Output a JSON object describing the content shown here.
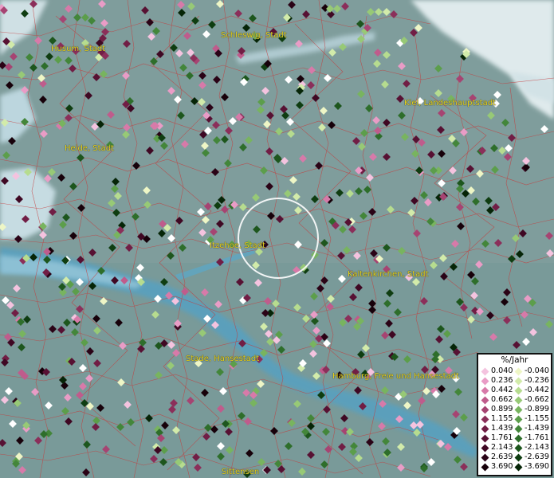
{
  "map": {
    "cities": [
      {
        "name": "Husum, Stadt"
      },
      {
        "name": "Schleswig, Stadt"
      },
      {
        "name": "Kiel, Landeshauptstadt"
      },
      {
        "name": "Heide, Stadt"
      },
      {
        "name": "Itzehoe, Stadt"
      },
      {
        "name": "Kaltenkirchen, Stadt"
      },
      {
        "name": "Stade, Hansestadt"
      },
      {
        "name": "Hamburg, Freie und Hansestadt"
      },
      {
        "name": "Sittensen"
      }
    ]
  },
  "legend": {
    "title": "%/Jahr",
    "positive": [
      {
        "value": "0.040",
        "color": "#f4c3df"
      },
      {
        "value": "0.236",
        "color": "#e99cc6"
      },
      {
        "value": "0.442",
        "color": "#d77aa9"
      },
      {
        "value": "0.662",
        "color": "#bf5c8c"
      },
      {
        "value": "0.899",
        "color": "#a64472"
      },
      {
        "value": "1.155",
        "color": "#8b2f5a"
      },
      {
        "value": "1.439",
        "color": "#711e45"
      },
      {
        "value": "1.761",
        "color": "#571133"
      },
      {
        "value": "2.143",
        "color": "#3f0823"
      },
      {
        "value": "2.639",
        "color": "#2a0316"
      },
      {
        "value": "3.690",
        "color": "#17010a"
      }
    ],
    "negative": [
      {
        "value": "-0.040",
        "color": "#eef6c6"
      },
      {
        "value": "-0.236",
        "color": "#d2ebaa"
      },
      {
        "value": "-0.442",
        "color": "#b6dc8f"
      },
      {
        "value": "-0.662",
        "color": "#97c976"
      },
      {
        "value": "-0.899",
        "color": "#78b45f"
      },
      {
        "value": "-1.155",
        "color": "#5c9e4b"
      },
      {
        "value": "-1.439",
        "color": "#43863a"
      },
      {
        "value": "-1.761",
        "color": "#2e6e2b"
      },
      {
        "value": "-2.143",
        "color": "#1d561d"
      },
      {
        "value": "-2.639",
        "color": "#0f3d11"
      },
      {
        "value": "-3.690",
        "color": "#062507"
      }
    ]
  }
}
